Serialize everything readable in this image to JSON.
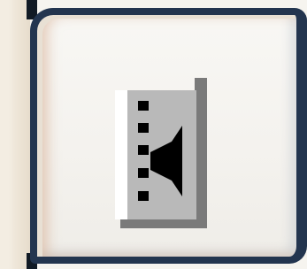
{
  "toolbar": {
    "button": {
      "label": "",
      "icon": "splitter-bar-icon",
      "state": "raised"
    }
  },
  "colors": {
    "button_border": "#23354f",
    "button_face": "#f4f2ee",
    "icon_panel": "#b9b9b9",
    "icon_shadow": "#7a7a7a",
    "icon_highlight": "#ffffff",
    "icon_glyph": "#000000"
  }
}
